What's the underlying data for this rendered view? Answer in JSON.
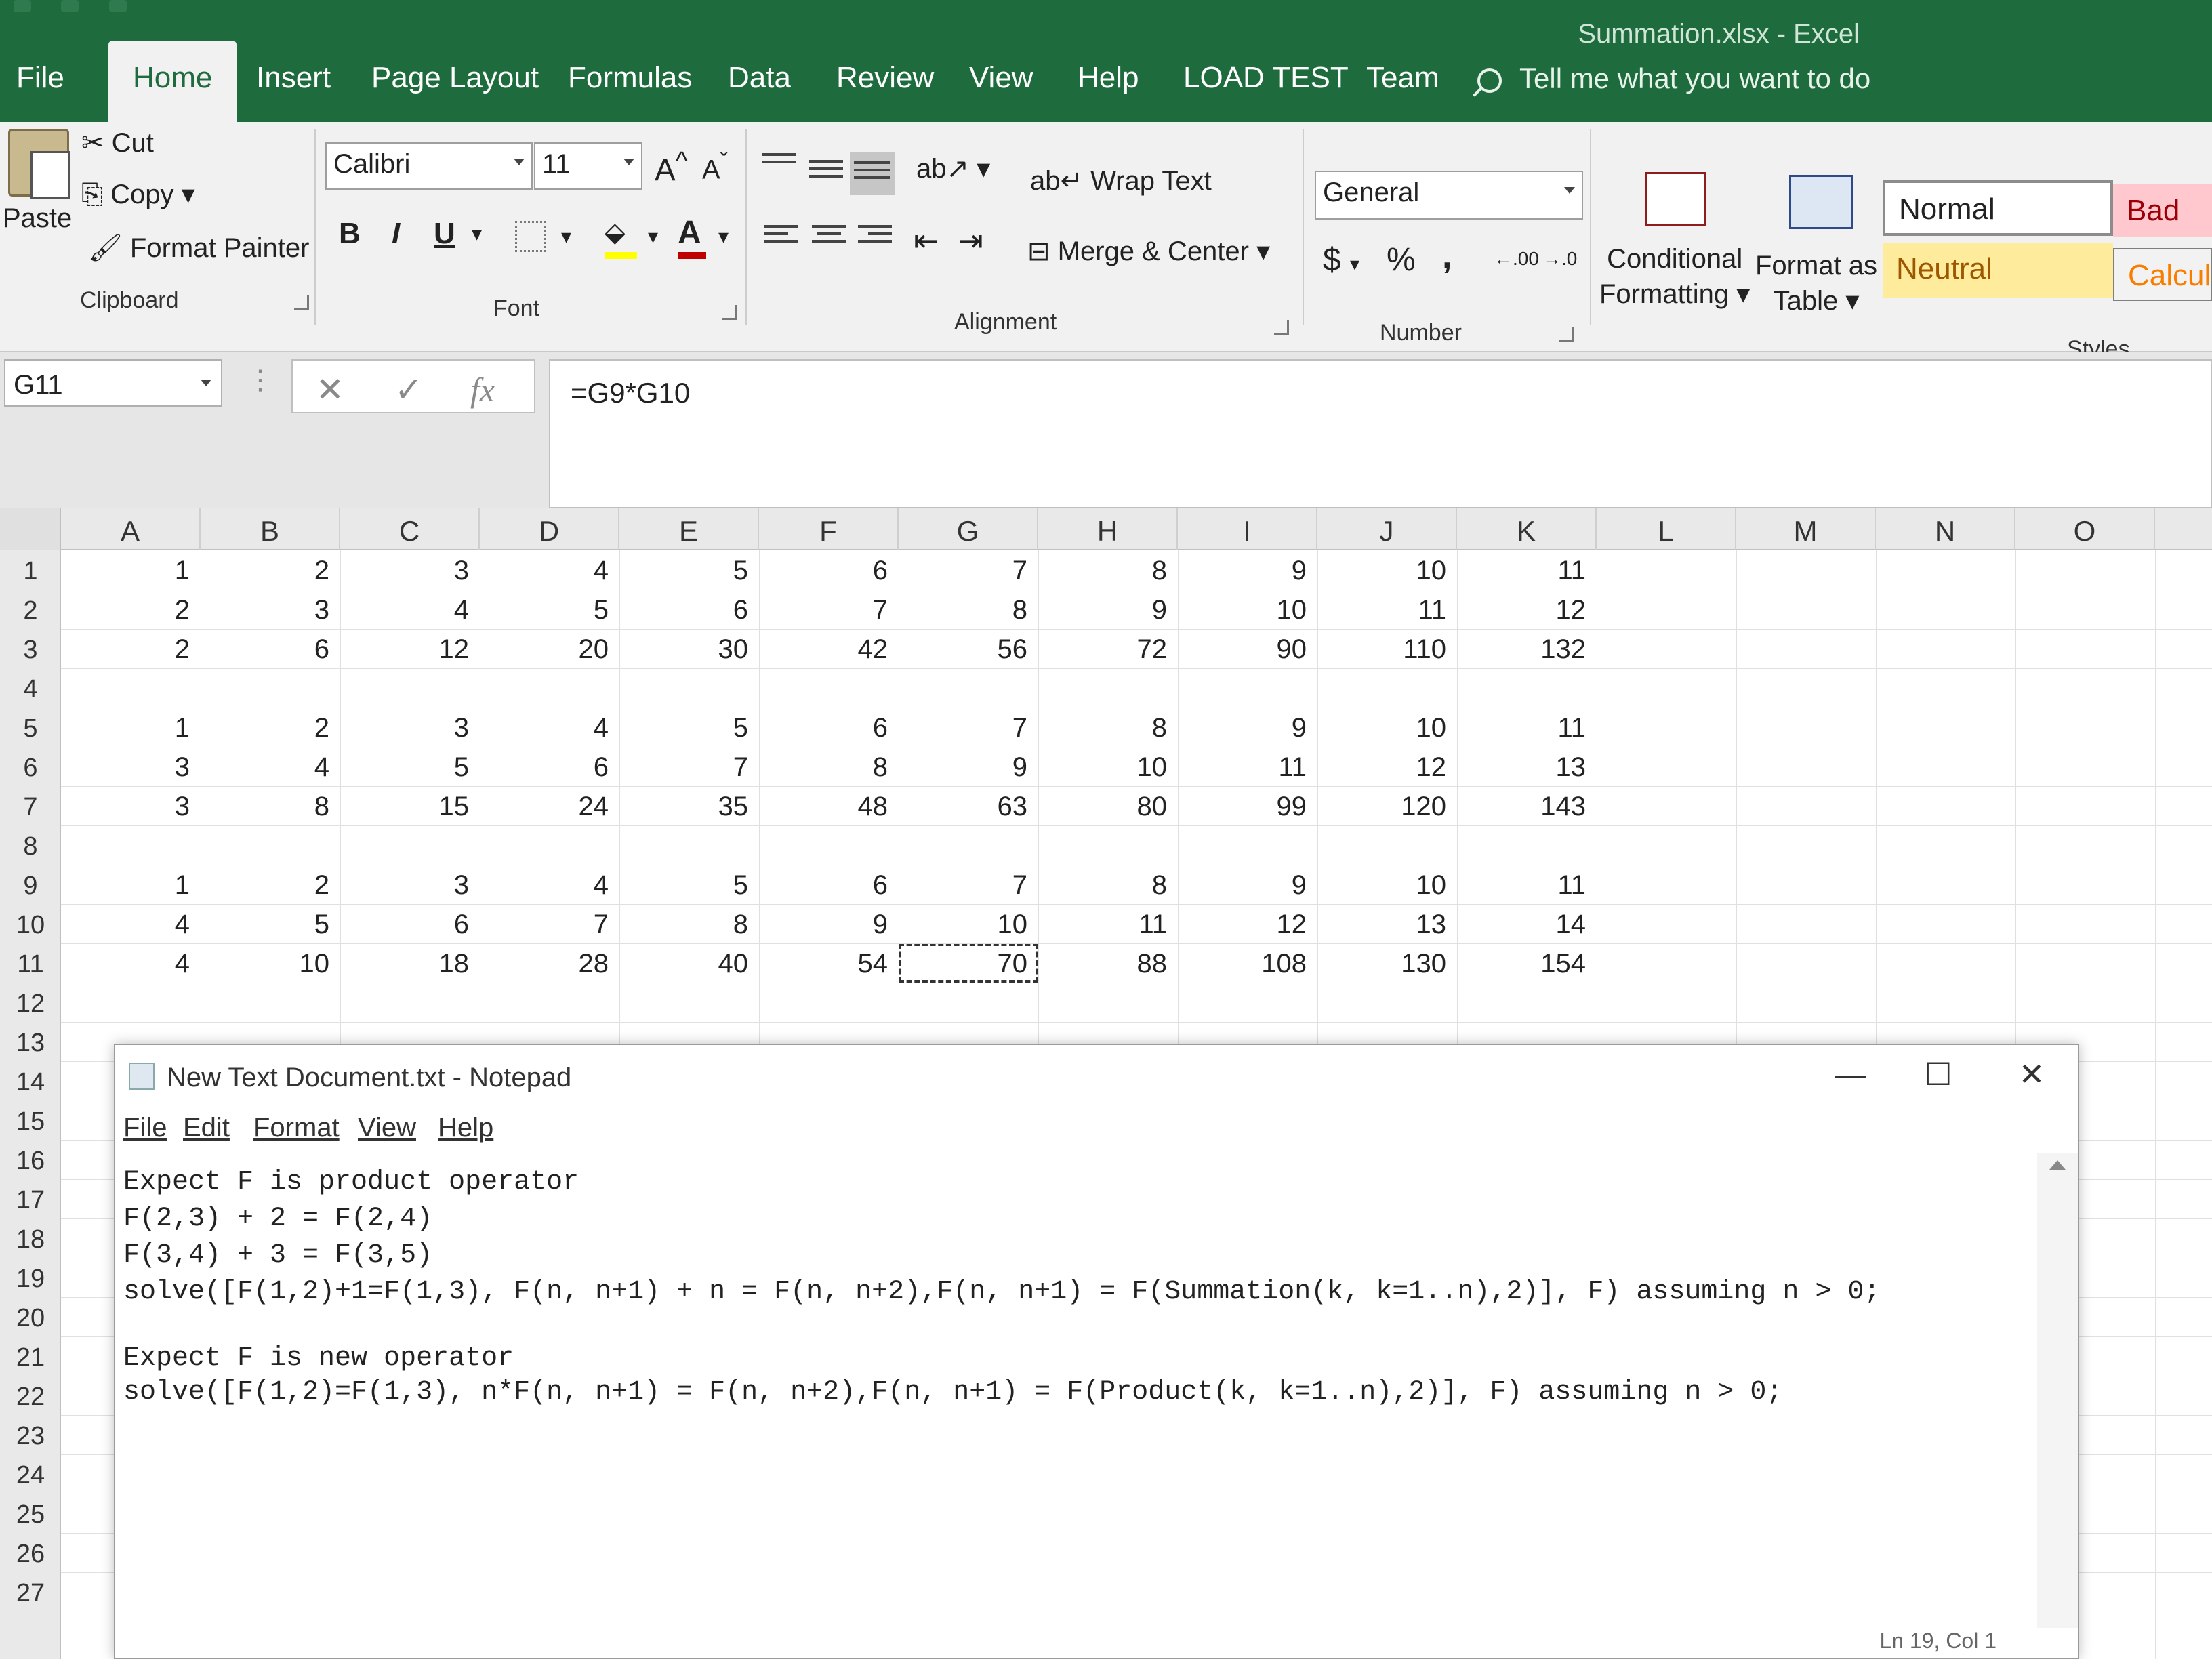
{
  "window": {
    "title": "Summation.xlsx  -  Excel"
  },
  "tabs": [
    {
      "label": "File"
    },
    {
      "label": "Home"
    },
    {
      "label": "Insert"
    },
    {
      "label": "Page Layout"
    },
    {
      "label": "Formulas"
    },
    {
      "label": "Data"
    },
    {
      "label": "Review"
    },
    {
      "label": "View"
    },
    {
      "label": "Help"
    },
    {
      "label": "LOAD TEST"
    },
    {
      "label": "Team"
    }
  ],
  "tell_me": "Tell me what you want to do",
  "ribbon": {
    "clipboard": {
      "paste": "Paste",
      "cut": "Cut",
      "copy": "Copy",
      "format_painter": "Format Painter",
      "group": "Clipboard"
    },
    "font": {
      "family": "Calibri",
      "size": "11",
      "bold": "B",
      "italic": "I",
      "underline": "U",
      "group": "Font",
      "font_color": "#c00000",
      "fill_color": "#ffff00"
    },
    "alignment": {
      "wrap_text": "Wrap Text",
      "merge_center": "Merge & Center",
      "group": "Alignment"
    },
    "number": {
      "format": "General",
      "dollar": "$",
      "percent": "%",
      "comma": ",",
      "inc_decimal": ".00",
      "dec_decimal": ".0",
      "group": "Number"
    },
    "styles": {
      "conditional_formatting_1": "Conditional",
      "conditional_formatting_2": "Formatting",
      "format_as_table_1": "Format as",
      "format_as_table_2": "Table",
      "normal": "Normal",
      "bad": "Bad",
      "neutral": "Neutral",
      "calculation": "Calcula",
      "group": "Styles",
      "neutral_color": "#ffeb9c",
      "bad_color": "#ffc7ce"
    }
  },
  "formula_bar": {
    "name_box": "G11",
    "cancel": "✕",
    "enter": "✓",
    "fx": "fx",
    "formula": "=G9*G10"
  },
  "sheet": {
    "columns": [
      "A",
      "B",
      "C",
      "D",
      "E",
      "F",
      "G",
      "H",
      "I",
      "J",
      "K",
      "L",
      "M",
      "N",
      "O"
    ],
    "row_numbers": [
      "1",
      "2",
      "3",
      "4",
      "5",
      "6",
      "7",
      "8",
      "9",
      "10",
      "11",
      "12",
      "13",
      "14",
      "15",
      "16",
      "17",
      "18",
      "19",
      "20",
      "21",
      "22",
      "23",
      "24",
      "25",
      "26",
      "27"
    ],
    "rows": [
      {
        "row": 1,
        "cells": [
          "1",
          "2",
          "3",
          "4",
          "5",
          "6",
          "7",
          "8",
          "9",
          "10",
          "11"
        ]
      },
      {
        "row": 2,
        "cells": [
          "2",
          "3",
          "4",
          "5",
          "6",
          "7",
          "8",
          "9",
          "10",
          "11",
          "12"
        ]
      },
      {
        "row": 3,
        "cells": [
          "2",
          "6",
          "12",
          "20",
          "30",
          "42",
          "56",
          "72",
          "90",
          "110",
          "132"
        ]
      },
      {
        "row": 5,
        "cells": [
          "1",
          "2",
          "3",
          "4",
          "5",
          "6",
          "7",
          "8",
          "9",
          "10",
          "11"
        ]
      },
      {
        "row": 6,
        "cells": [
          "3",
          "4",
          "5",
          "6",
          "7",
          "8",
          "9",
          "10",
          "11",
          "12",
          "13"
        ]
      },
      {
        "row": 7,
        "cells": [
          "3",
          "8",
          "15",
          "24",
          "35",
          "48",
          "63",
          "80",
          "99",
          "120",
          "143"
        ]
      },
      {
        "row": 9,
        "cells": [
          "1",
          "2",
          "3",
          "4",
          "5",
          "6",
          "7",
          "8",
          "9",
          "10",
          "11"
        ]
      },
      {
        "row": 10,
        "cells": [
          "4",
          "5",
          "6",
          "7",
          "8",
          "9",
          "10",
          "11",
          "12",
          "13",
          "14"
        ]
      },
      {
        "row": 11,
        "cells": [
          "4",
          "10",
          "18",
          "28",
          "40",
          "54",
          "70",
          "88",
          "108",
          "130",
          "154"
        ]
      }
    ]
  },
  "notepad": {
    "title": "New Text Document.txt - Notepad",
    "menu": [
      "File",
      "Edit",
      "Format",
      "View",
      "Help"
    ],
    "minimize": "—",
    "maximize": "☐",
    "close": "✕",
    "lines": [
      "Expect F is product operator",
      "F(2,3) + 2 = F(2,4)",
      "F(3,4) + 3 = F(3,5)",
      "solve([F(1,2)+1=F(1,3), F(n, n+1) + n = F(n, n+2),F(n, n+1) = F(Summation(k, k=1..n),2)], F) assuming n > 0;",
      "",
      "Expect F is new operator",
      "solve([F(1,2)=F(1,3), n*F(n, n+1) = F(n, n+2),F(n, n+1) = F(Product(k, k=1..n),2)], F) assuming n > 0;"
    ],
    "status": "Ln 19, Col 1"
  }
}
